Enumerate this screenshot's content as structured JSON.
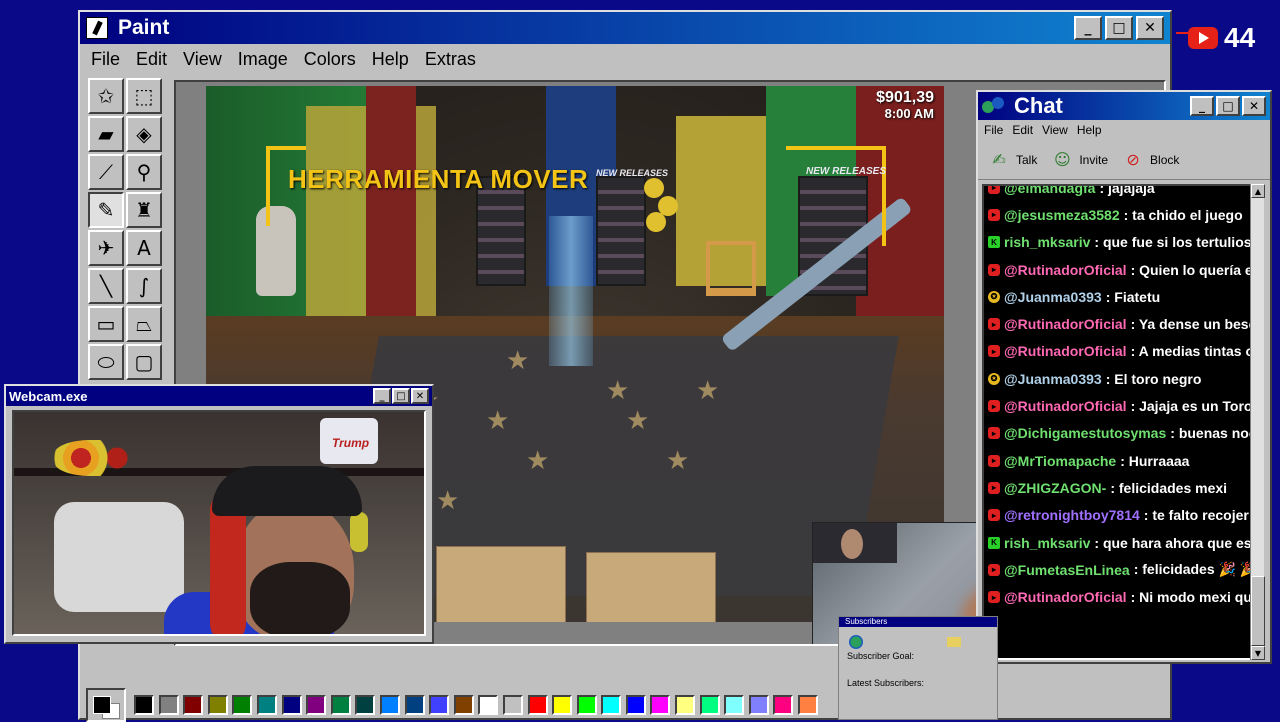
{
  "paint": {
    "title": "Paint",
    "menu": [
      "File",
      "Edit",
      "View",
      "Image",
      "Colors",
      "Help",
      "Extras"
    ],
    "tools": [
      {
        "name": "free-select-tool",
        "glyph": "✩"
      },
      {
        "name": "rect-select-tool",
        "glyph": "⬚"
      },
      {
        "name": "eraser-tool",
        "glyph": "▰"
      },
      {
        "name": "fill-tool",
        "glyph": "◈"
      },
      {
        "name": "color-picker-tool",
        "glyph": "⟋"
      },
      {
        "name": "magnifier-tool",
        "glyph": "⚲"
      },
      {
        "name": "pencil-tool",
        "glyph": "✎"
      },
      {
        "name": "brush-tool",
        "glyph": "♜"
      },
      {
        "name": "airbrush-tool",
        "glyph": "✈"
      },
      {
        "name": "text-tool",
        "glyph": "A"
      },
      {
        "name": "line-tool",
        "glyph": "╲"
      },
      {
        "name": "curve-tool",
        "glyph": "∫"
      },
      {
        "name": "rectangle-tool",
        "glyph": "▭"
      },
      {
        "name": "polygon-tool",
        "glyph": "⏢"
      },
      {
        "name": "ellipse-tool",
        "glyph": "⬭"
      },
      {
        "name": "rounded-rect-tool",
        "glyph": "▢"
      }
    ],
    "active_tool_index": 6,
    "palette": [
      "#000000",
      "#808080",
      "#800000",
      "#808000",
      "#008000",
      "#008080",
      "#000080",
      "#800080",
      "#008040",
      "#004040",
      "#0080ff",
      "#004080",
      "#4040ff",
      "#804000",
      "#ffffff",
      "#c0c0c0",
      "#ff0000",
      "#ffff00",
      "#00ff00",
      "#00ffff",
      "#0000ff",
      "#ff00ff",
      "#ffff80",
      "#00ff80",
      "#80ffff",
      "#8080ff",
      "#ff0080",
      "#ff8040"
    ]
  },
  "game": {
    "money": "$901,39",
    "time": "8:00 AM",
    "tool_label": "HERRAMIENTA MOVER",
    "sign_left": "NEW RELEASES",
    "sign_right": "NEW RELEASES"
  },
  "webcam": {
    "title": "Webcam.exe",
    "can_text": "Trump"
  },
  "chat": {
    "title": "Chat",
    "menu": [
      "File",
      "Edit",
      "View",
      "Help"
    ],
    "toolbar": [
      {
        "label": "Talk",
        "icon": "talk-icon",
        "glyph": "✍"
      },
      {
        "label": "Invite",
        "icon": "invite-icon",
        "glyph": "☺"
      },
      {
        "label": "Block",
        "icon": "block-icon",
        "glyph": "⊘"
      }
    ],
    "messages": [
      {
        "badge": "yt",
        "user": "@elmandagfa",
        "color": "#6fe06f",
        "text": ": jajajaja"
      },
      {
        "badge": "yt",
        "user": "@jesusmeza3582",
        "color": "#6fe06f",
        "text": ": ta chido el juego"
      },
      {
        "badge": "kick",
        "user": "rish_mksariv",
        "color": "#6fe06f",
        "text": ": que fue si los tertulios lo dice"
      },
      {
        "badge": "yt",
        "user": "@RutinadorOficial",
        "color": "#ff69b4",
        "text": ": Quien lo quería en un pr"
      },
      {
        "badge": "sub",
        "user": "@Juanma0393",
        "color": "#b0d0e8",
        "text": ": Fiatetu"
      },
      {
        "badge": "yt",
        "user": "@RutinadorOficial",
        "color": "#ff69b4",
        "text": ": Ya dense un beso mejor"
      },
      {
        "badge": "yt",
        "user": "@RutinadorOficial",
        "color": "#ff69b4",
        "text": ": A medias tintas o pacta"
      },
      {
        "badge": "sub",
        "user": "@Juanma0393",
        "color": "#b0d0e8",
        "text": ": El toro negro"
      },
      {
        "badge": "yt",
        "user": "@RutinadorOficial",
        "color": "#ff69b4",
        "text": ": Jajaja es un Toro Negro"
      },
      {
        "badge": "yt",
        "user": "@Dichigamestutosymas",
        "color": "#6fe06f",
        "text": ": buenas noches ta"
      },
      {
        "badge": "yt",
        "user": "@MrTiomapache",
        "color": "#6fe06f",
        "text": ": Hurraaaa"
      },
      {
        "badge": "yt",
        "user": "@ZHIGZAGON-",
        "color": "#6fe06f",
        "text": ": felicidades mexi"
      },
      {
        "badge": "yt",
        "user": "@retronightboy7814",
        "color": "#a070ff",
        "text": ": te falto recojer de las"
      },
      {
        "badge": "kick",
        "user": "rish_mksariv",
        "color": "#6fe06f",
        "text": ": que hara ahora que es millona"
      },
      {
        "badge": "yt",
        "user": "@FumetasEnLinea",
        "color": "#6fe06f",
        "text": ": felicidades 🎉 🎉 🎉"
      },
      {
        "badge": "yt",
        "user": "@RutinadorOficial",
        "color": "#ff69b4",
        "text": ": Ni modo mexi que doble"
      }
    ]
  },
  "subscribers": {
    "title": "Subscribers",
    "goal_label": "Subscriber Goal:",
    "latest_label": "Latest Subscribers:"
  },
  "youtube": {
    "viewer_count": "44"
  }
}
